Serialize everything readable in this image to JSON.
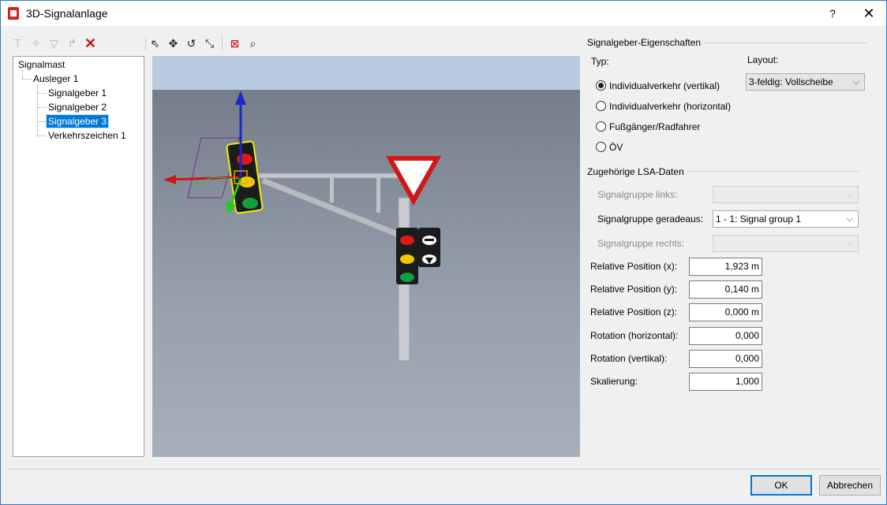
{
  "window": {
    "title": "3D-Signalanlage",
    "help_label": "?",
    "close_label": "✕"
  },
  "toolbar_left": [
    {
      "name": "add-mast-icon",
      "glyph": "⊤",
      "enabled": false
    },
    {
      "name": "add-signal-icon",
      "glyph": "✧",
      "enabled": false
    },
    {
      "name": "add-sign-icon",
      "glyph": "▽",
      "enabled": false
    },
    {
      "name": "add-arm-icon",
      "glyph": "↱",
      "enabled": false
    },
    {
      "name": "delete-icon",
      "glyph": "✕",
      "enabled": true
    }
  ],
  "toolbar_view": [
    {
      "name": "select-tool-icon",
      "glyph": "⇖"
    },
    {
      "name": "move-tool-icon",
      "glyph": "✥"
    },
    {
      "name": "rotate-tool-icon",
      "glyph": "↺"
    },
    {
      "name": "scale-tool-icon",
      "glyph": "⤡"
    },
    {
      "name": "fit-view-icon",
      "glyph": "⊠"
    },
    {
      "name": "zoom-icon",
      "glyph": "⌕"
    }
  ],
  "tree": {
    "items": [
      {
        "label": "Signalmast",
        "level": 0
      },
      {
        "label": "Ausleger 1",
        "level": 1
      },
      {
        "label": "Signalgeber 1",
        "level": 2
      },
      {
        "label": "Signalgeber 2",
        "level": 2
      },
      {
        "label": "Signalgeber 3",
        "level": 2,
        "selected": true
      },
      {
        "label": "Verkehrszeichen 1",
        "level": 2
      }
    ]
  },
  "props": {
    "section_title": "Signalgeber-Eigenschaften",
    "typ_label": "Typ:",
    "layout_label": "Layout:",
    "layout_value": "3-feldig: Vollscheibe",
    "types": [
      {
        "label": "Individualverkehr (vertikal)",
        "checked": true
      },
      {
        "label": "Individualverkehr (horizontal)",
        "checked": false
      },
      {
        "label": "Fußgänger/Radfahrer",
        "checked": false
      },
      {
        "label": "ÖV",
        "checked": false
      }
    ]
  },
  "lsa": {
    "section_title": "Zugehörige LSA-Daten",
    "links_label": "Signalgruppe links:",
    "links_value": "",
    "geradeaus_label": "Signalgruppe geradeaus:",
    "geradeaus_value": "1 - 1: Signal group 1",
    "rechts_label": "Signalgruppe rechts:",
    "rechts_value": ""
  },
  "fields": [
    {
      "label": "Relative Position (x):",
      "value": "1,923 m"
    },
    {
      "label": "Relative Position (y):",
      "value": "0,140 m"
    },
    {
      "label": "Relative Position (z):",
      "value": "0,000 m"
    },
    {
      "label": "Rotation (horizontal):",
      "value": "0,000"
    },
    {
      "label": "Rotation (vertikal):",
      "value": "0,000"
    },
    {
      "label": "Skalierung:",
      "value": "1,000"
    }
  ],
  "buttons": {
    "ok": "OK",
    "cancel": "Abbrechen"
  },
  "colors": {
    "accent": "#0078d7",
    "delete": "#cc1010",
    "signal_red": "#e01818",
    "signal_yellow": "#f0c800",
    "signal_green": "#10a040",
    "gizmo_red": "#c81818",
    "gizmo_green": "#28c828",
    "gizmo_blue": "#1a28c8",
    "selection": "#f0f000"
  }
}
